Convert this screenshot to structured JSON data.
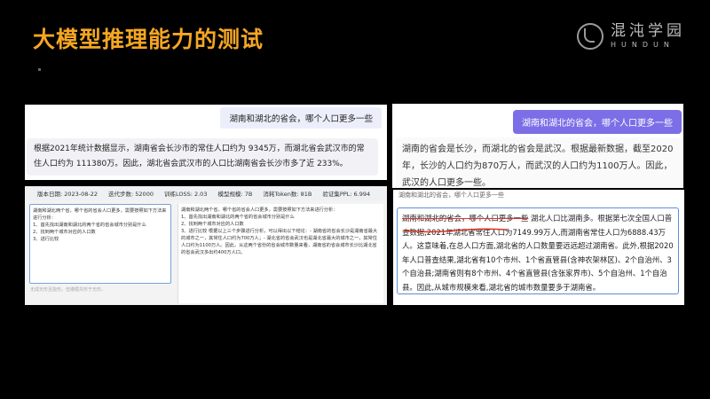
{
  "slide": {
    "title": "大模型推理能力的测试"
  },
  "logo": {
    "cn": "混沌学园",
    "en": "HUNDUN"
  },
  "panel_top_left": {
    "question": "湖南和湖北的省会，哪个人口更多一些",
    "answer": "根据2021年统计数据显示，湖南省会长沙市的常住人口约为 9345万，而湖北省会武汉市的常住人口约为 111380万。因此，湖北省会武汉市的人口比湖南省会长沙市多了近 233%。"
  },
  "panel_top_right": {
    "question": "湖南和湖北的省会，哪个人口更多一些",
    "answer": "湖南的省会是长沙，而湖北的省会是武汉。根据最新数据，截至2020年，长沙的人口约为870万人，而武汉的人口约为1100万人。因此，武汉的人口更多一些。"
  },
  "panel_bottom_left": {
    "stats": [
      "版本日期: 2023-08-22",
      "迭代步数: 52000",
      "训练LOSS: 2.03",
      "模型规模: 7B",
      "消耗Token数: 81B",
      "验证集PPL: 6.994"
    ],
    "left_text": "湖南和湖北两个省，哪个省的省会人口更多，需要按照如下方法来进行分析：\n1、首先找出湖南和湖北的两个省的省会城市分别是什么\n2、找到两个城市对应的人口数\n3、进行比较",
    "right_text": "湖南和湖北两个省，哪个省的省会人口更多，需要按照如下方法来进行分析：\n1、首先找出湖南和湖北的两个省的省会城市分别是什么\n2、找到两个城市对应的人口数\n3、进行比较 根据以上三个步骤进行分析，可以得出以下结论：- 湖南省的省会长沙是湖南省最大的城市之一，其常住人口约为700万人；- 湖北省的省会武汉也是湖北省最大的城市之一，其常住人口约为1100万人。因此，从这两个省份的省会城市数量来看，湖南省的省会城市长沙比湖北省的省会武汉多出约400万人口。",
    "footnote": "无成无形且能形。但遵循共形于无形。"
  },
  "panel_bottom_right": {
    "partial_line": "湖南和湖北的省会，哪个人口更多一些",
    "answer_lead": "湖南和湖北的省会，哪个人口更多一些",
    "answer": "湖北人口比湖南多。根据第七次全国人口普查数据,2021年湖北省常住人口为7149.99万人,而湖南省常住人口为6888.43万人。这意味着,在总人口方面,湖北省的人口数量要远远超过湖南省。此外,根据2020年人口普查结果,湖北省有10个市州、1个省直管县(含神农架林区)、2个自治州、3个自治县;湖南省则有8个市州、4个省直管县(含张家界市)、5个自治州、1个自治县。因此,从城市规模来看,湖北省的城市数量要多于湖南省。"
  }
}
